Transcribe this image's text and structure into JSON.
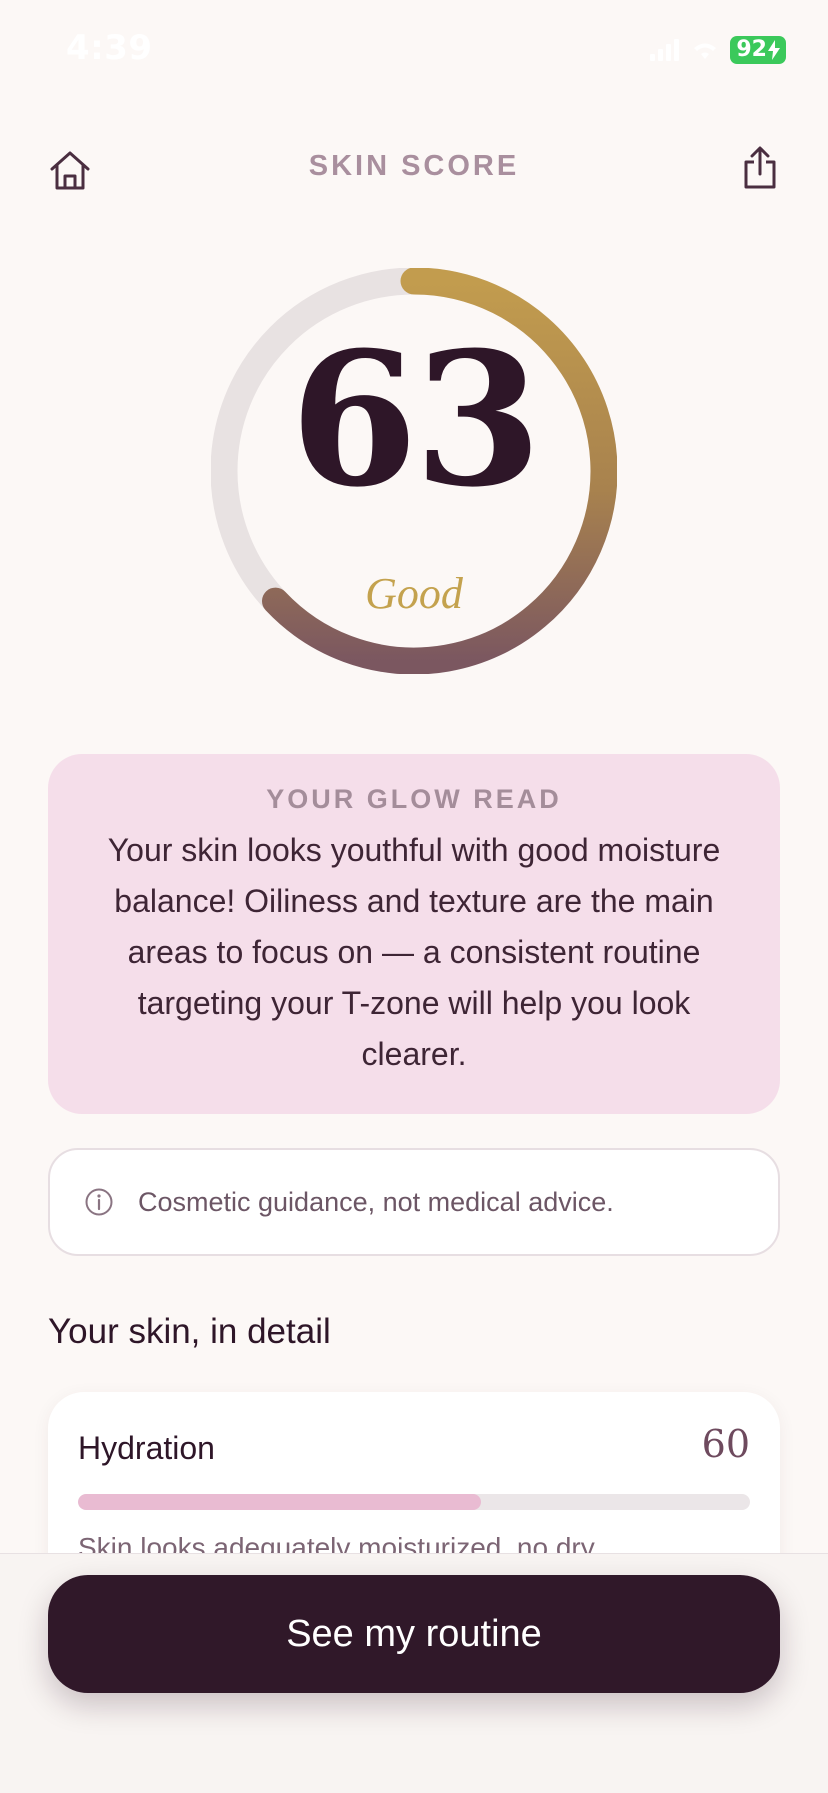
{
  "status_bar": {
    "time": "4:39",
    "battery": "92"
  },
  "header": {
    "title": "SKIN SCORE",
    "home_icon": "home-icon",
    "share_icon": "share-icon"
  },
  "score": {
    "value": "63",
    "fraction": 0.63,
    "label": "Good",
    "colors": {
      "track": "#E8E2E2",
      "gradient_start": "#C29C4E",
      "gradient_end": "#7B5760"
    }
  },
  "glow_read": {
    "title": "YOUR GLOW READ",
    "text": "Your skin looks youthful with good moisture balance! Oiliness and texture are the main areas to focus on — a consistent routine targeting your T-zone will help you look clearer."
  },
  "disclaimer": {
    "icon": "info-icon",
    "text": "Cosmetic guidance, not medical advice."
  },
  "detail": {
    "heading": "Your skin, in detail",
    "metrics": [
      {
        "name": "Hydration",
        "value": "60",
        "fraction": 0.6,
        "description": "Skin looks adequately moisturized, no dry"
      }
    ]
  },
  "cta": {
    "label": "See my routine"
  },
  "colors": {
    "background": "#FCF8F6",
    "card_pink": "#F5DEEA",
    "primary_dark": "#301829",
    "accent_gold": "#C4A24E",
    "bar_fill": "#E9BBD2"
  }
}
